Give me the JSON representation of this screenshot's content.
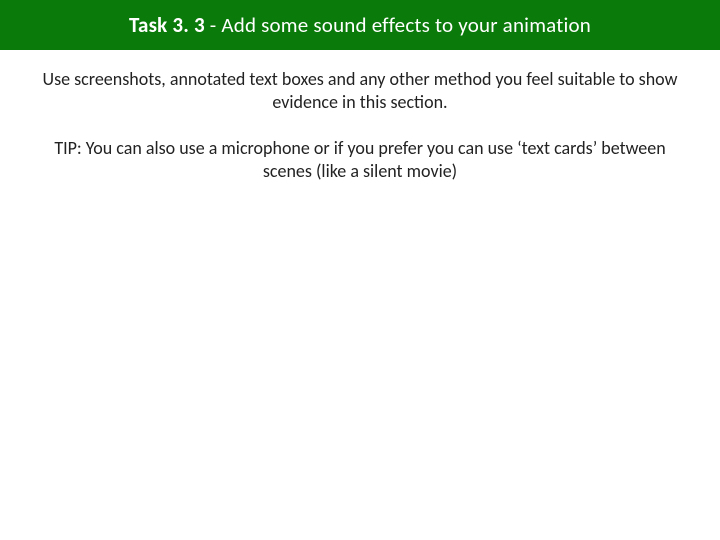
{
  "title": {
    "prefix": "Task 3. 3 ",
    "rest": "- Add some sound effects to your animation"
  },
  "body": {
    "instruction": "Use screenshots, annotated text boxes and any other method you feel suitable to show evidence in this section.",
    "tip": "TIP: You can also use a microphone or if you prefer you can use ‘text cards’ between scenes (like a silent movie)"
  }
}
